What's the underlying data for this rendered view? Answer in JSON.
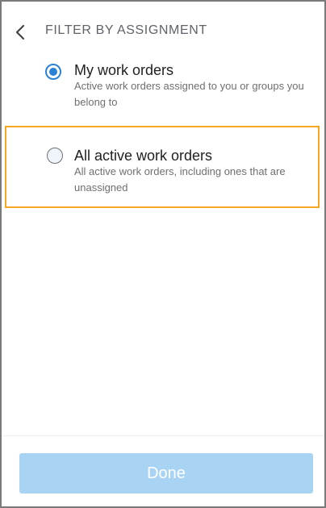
{
  "header": {
    "back_icon": "chevron-left-icon",
    "title": "FILTER BY ASSIGNMENT"
  },
  "options": [
    {
      "title": "My work orders",
      "description": "Active work orders assigned to you or groups you belong to",
      "selected": true
    },
    {
      "title": "All active work orders",
      "description": "All active work orders, including ones that are unassigned",
      "selected": false,
      "highlighted": true
    }
  ],
  "footer": {
    "done_label": "Done"
  },
  "colors": {
    "accent": "#2a82d6",
    "highlight_border": "#f5a623",
    "done_button_bg": "#a9d3f2"
  }
}
